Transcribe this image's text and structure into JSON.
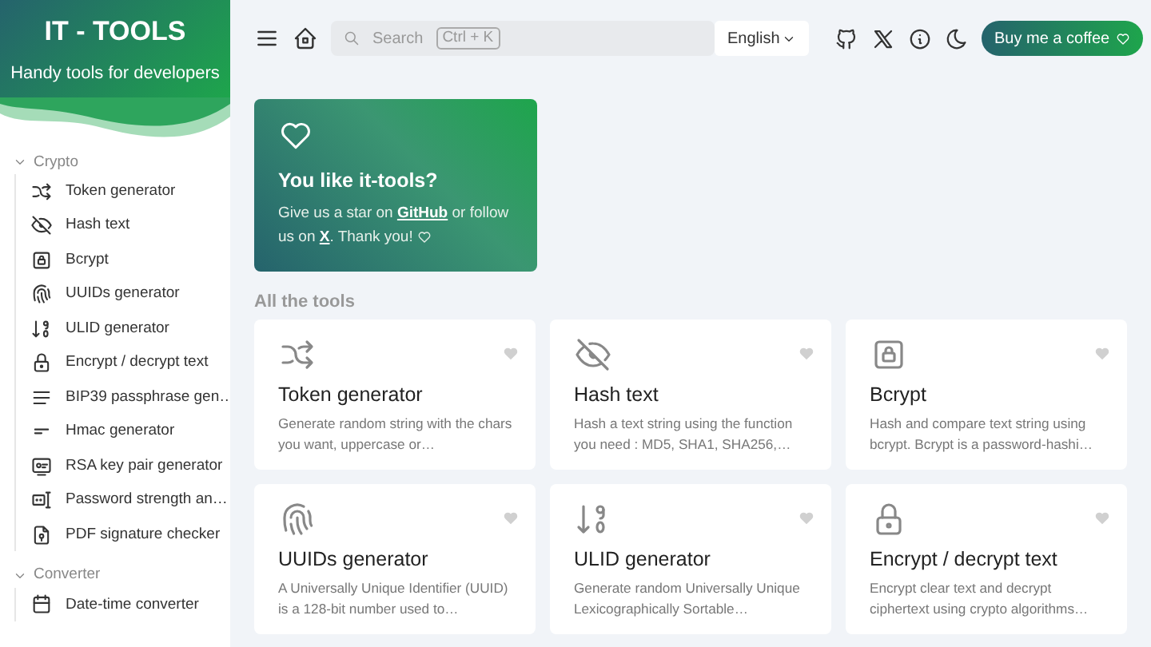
{
  "brand": {
    "title": "IT - TOOLS",
    "subtitle": "Handy tools for developers"
  },
  "sidebar": {
    "groups": [
      {
        "label": "Crypto",
        "expanded": true,
        "items": [
          {
            "label": "Token generator"
          },
          {
            "label": "Hash text"
          },
          {
            "label": "Bcrypt"
          },
          {
            "label": "UUIDs generator"
          },
          {
            "label": "ULID generator"
          },
          {
            "label": "Encrypt / decrypt text"
          },
          {
            "label": "BIP39 passphrase gen…"
          },
          {
            "label": "Hmac generator"
          },
          {
            "label": "RSA key pair generator"
          },
          {
            "label": "Password strength an…"
          },
          {
            "label": "PDF signature checker"
          }
        ]
      },
      {
        "label": "Converter",
        "expanded": true,
        "items": [
          {
            "label": "Date-time converter"
          }
        ]
      }
    ]
  },
  "header": {
    "search": {
      "placeholder": "Search",
      "shortcut": "Ctrl + K"
    },
    "language": "English",
    "coffee_button": "Buy me a coffee"
  },
  "promo": {
    "title": "You like it-tools?",
    "text_before": "Give us a star on",
    "link_1": "GitHub",
    "text_middle": "or follow us on",
    "link_2": "X",
    "text_after": ". Thank you!"
  },
  "section_title": "All the tools",
  "tools": [
    {
      "title": "Token generator",
      "description": "Generate random string with the chars you want, uppercase or…",
      "favorite": false
    },
    {
      "title": "Hash text",
      "description": "Hash a text string using the function you need : MD5, SHA1, SHA256,…",
      "favorite": false
    },
    {
      "title": "Bcrypt",
      "description": "Hash and compare text string using bcrypt. Bcrypt is a password-hashi…",
      "favorite": false
    },
    {
      "title": "UUIDs generator",
      "description": "A Universally Unique Identifier (UUID) is a 128-bit number used to…",
      "favorite": false
    },
    {
      "title": "ULID generator",
      "description": "Generate random Universally Unique Lexicographically Sortable…",
      "favorite": false
    },
    {
      "title": "Encrypt / decrypt text",
      "description": "Encrypt clear text and decrypt ciphertext using crypto algorithms…",
      "favorite": false
    }
  ]
}
